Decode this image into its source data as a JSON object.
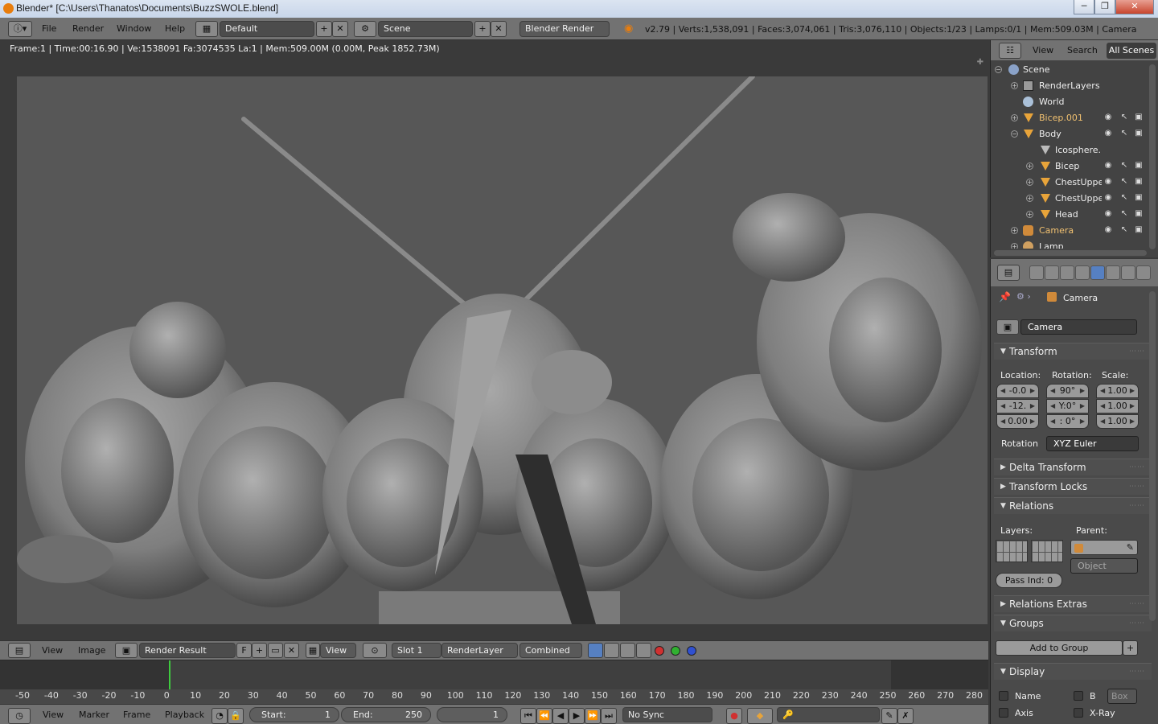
{
  "window": {
    "title": "Blender* [C:\\Users\\Thanatos\\Documents\\BuzzSWOLE.blend]",
    "minimize": "─",
    "restore": "❐",
    "close": "✕"
  },
  "info": {
    "menus": [
      "File",
      "Render",
      "Window",
      "Help"
    ],
    "screen_layout": "Default",
    "scene": "Scene",
    "engine": "Blender Render",
    "stats": "v2.79 | Verts:1,538,091 | Faces:3,074,061 | Tris:3,076,110 | Objects:1/23 | Lamps:0/1 | Mem:509.03M | Camera"
  },
  "render_meta": "Frame:1 | Time:00:16.90 | Ve:1538091 Fa:3074535 La:1 | Mem:509.00M (0.00M, Peak 1852.73M)",
  "image_editor": {
    "menus": [
      "View",
      "Image"
    ],
    "image_name": "Render Result",
    "fake_user": "F",
    "view_label": "View",
    "slot": "Slot 1",
    "layer": "RenderLayer",
    "pass": "Combined"
  },
  "timeline": {
    "ticks": [
      "-50",
      "-40",
      "-30",
      "-20",
      "-10",
      "0",
      "10",
      "20",
      "30",
      "40",
      "50",
      "60",
      "70",
      "80",
      "90",
      "100",
      "110",
      "120",
      "130",
      "140",
      "150",
      "160",
      "170",
      "180",
      "190",
      "200",
      "210",
      "220",
      "230",
      "240",
      "250",
      "260",
      "270",
      "280"
    ],
    "menus": [
      "View",
      "Marker",
      "Frame",
      "Playback"
    ],
    "start_label": "Start:",
    "start_value": "1",
    "end_label": "End:",
    "end_value": "250",
    "current_frame": "1",
    "sync": "No Sync"
  },
  "outliner": {
    "menus": [
      "View",
      "Search"
    ],
    "filter": "All Scenes",
    "items": [
      {
        "name": "Scene"
      },
      {
        "name": "RenderLayers"
      },
      {
        "name": "World"
      },
      {
        "name": "Bicep.001"
      },
      {
        "name": "Body"
      },
      {
        "name": "Icosphere."
      },
      {
        "name": "Bicep"
      },
      {
        "name": "ChestUppe"
      },
      {
        "name": "ChestUppe"
      },
      {
        "name": "Head"
      },
      {
        "name": "Camera"
      },
      {
        "name": "Lamp"
      }
    ]
  },
  "properties": {
    "breadcrumb": "Camera",
    "object_name": "Camera",
    "transform": {
      "title": "Transform",
      "location_label": "Location:",
      "rotation_label": "Rotation:",
      "scale_label": "Scale:",
      "location": [
        "-0.0",
        "-12.",
        "0.00"
      ],
      "rotation": [
        "90°",
        "Y:0°",
        ": 0°"
      ],
      "scale": [
        "1.00",
        "1.00",
        "1.00"
      ],
      "rotation_mode_label": "Rotation",
      "rotation_mode": "XYZ Euler"
    },
    "panels": {
      "delta": "Delta Transform",
      "locks": "Transform Locks",
      "relations": "Relations",
      "relations_extras": "Relations Extras",
      "groups": "Groups",
      "display": "Display"
    },
    "relations": {
      "layers_label": "Layers:",
      "parent_label": "Parent:",
      "parent_type": "Object",
      "pass_index": "Pass Ind: 0"
    },
    "groups": {
      "add_label": "Add to Group"
    },
    "display": {
      "name": "Name",
      "b": "B",
      "box": "Box",
      "axis": "Axis",
      "xray": "X-Ray"
    }
  }
}
